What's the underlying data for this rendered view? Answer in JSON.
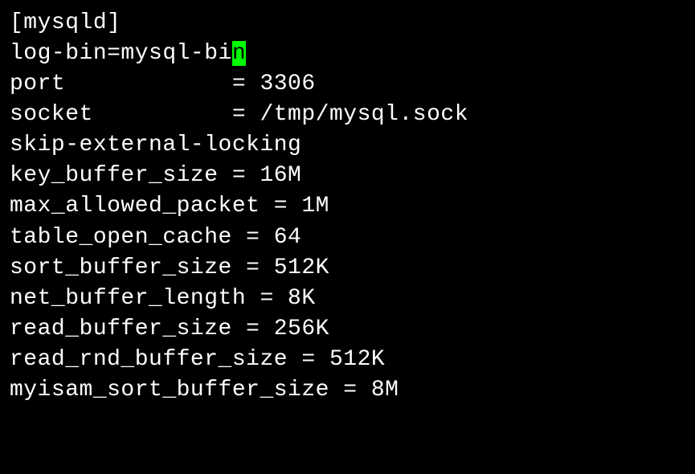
{
  "config": {
    "section": "[mysqld]",
    "lines": [
      {
        "pre": "log-bin=mysql-bi",
        "cursor": "n"
      },
      {
        "text": "port            = 3306"
      },
      {
        "text": "socket          = /tmp/mysql.sock"
      },
      {
        "text": "skip-external-locking"
      },
      {
        "text": "key_buffer_size = 16M"
      },
      {
        "text": "max_allowed_packet = 1M"
      },
      {
        "text": "table_open_cache = 64"
      },
      {
        "text": "sort_buffer_size = 512K"
      },
      {
        "text": "net_buffer_length = 8K"
      },
      {
        "text": "read_buffer_size = 256K"
      },
      {
        "text": "read_rnd_buffer_size = 512K"
      },
      {
        "text": "myisam_sort_buffer_size = 8M"
      }
    ]
  }
}
